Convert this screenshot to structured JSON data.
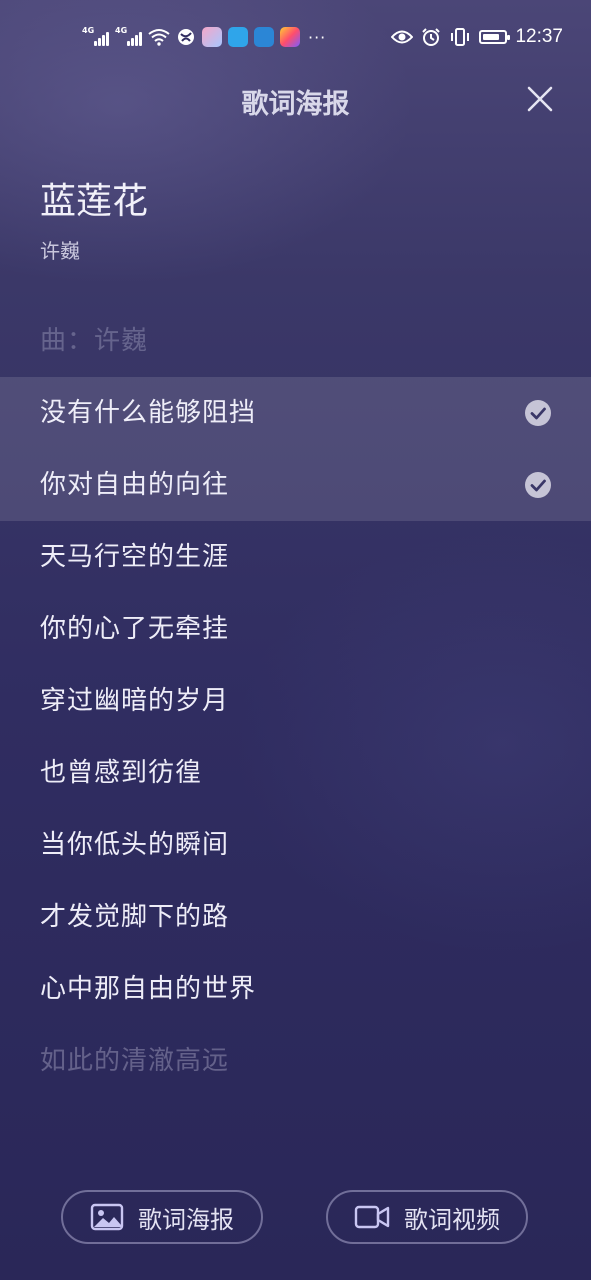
{
  "status_bar": {
    "net1": "4G",
    "net2": "4G",
    "more": "···",
    "time": "12:37",
    "battery_level": 0.8
  },
  "header": {
    "title": "歌词海报"
  },
  "song": {
    "title": "蓝莲花",
    "artist": "许巍"
  },
  "lyrics": [
    {
      "text": "曲：许巍",
      "selected": false,
      "faded": "top"
    },
    {
      "text": "没有什么能够阻挡",
      "selected": true
    },
    {
      "text": "你对自由的向往",
      "selected": true
    },
    {
      "text": "天马行空的生涯",
      "selected": false
    },
    {
      "text": "你的心了无牵挂",
      "selected": false
    },
    {
      "text": "穿过幽暗的岁月",
      "selected": false
    },
    {
      "text": "也曾感到彷徨",
      "selected": false
    },
    {
      "text": "当你低头的瞬间",
      "selected": false
    },
    {
      "text": "才发觉脚下的路",
      "selected": false
    },
    {
      "text": "心中那自由的世界",
      "selected": false
    },
    {
      "text": "如此的清澈高远",
      "selected": false,
      "faded": "bottom"
    }
  ],
  "actions": {
    "poster_label": "歌词海报",
    "video_label": "歌词视频"
  },
  "colors": {
    "background": "#302d61",
    "accent": "#c6c4d6"
  }
}
